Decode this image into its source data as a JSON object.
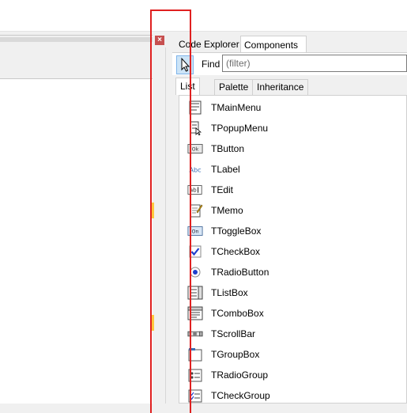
{
  "window": {
    "close_glyph": "×"
  },
  "tabs": {
    "code_explorer": "Code Explorer",
    "components": "Components"
  },
  "toolbar": {
    "pointer_icon": "arrow-cursor-icon",
    "find_label": "Find",
    "filter_placeholder": "(filter)",
    "filter_value": ""
  },
  "subtabs": {
    "list": "List",
    "palette": "Palette",
    "inheritance": "Inheritance"
  },
  "components": [
    {
      "label": "TMainMenu",
      "icon": "mainmenu-icon"
    },
    {
      "label": "TPopupMenu",
      "icon": "popupmenu-icon"
    },
    {
      "label": "TButton",
      "icon": "button-icon"
    },
    {
      "label": "TLabel",
      "icon": "label-icon"
    },
    {
      "label": "TEdit",
      "icon": "edit-icon"
    },
    {
      "label": "TMemo",
      "icon": "memo-icon"
    },
    {
      "label": "TToggleBox",
      "icon": "togglebox-icon"
    },
    {
      "label": "TCheckBox",
      "icon": "checkbox-icon"
    },
    {
      "label": "TRadioButton",
      "icon": "radiobutton-icon"
    },
    {
      "label": "TListBox",
      "icon": "listbox-icon"
    },
    {
      "label": "TComboBox",
      "icon": "combobox-icon"
    },
    {
      "label": "TScrollBar",
      "icon": "scrollbar-icon"
    },
    {
      "label": "TGroupBox",
      "icon": "groupbox-icon"
    },
    {
      "label": "TRadioGroup",
      "icon": "radiogroup-icon"
    },
    {
      "label": "TCheckGroup",
      "icon": "checkgroup-icon"
    }
  ],
  "icon_text": {
    "button": "Ok",
    "label": "Abc",
    "edit": "ab",
    "togglebox": "On"
  },
  "colors": {
    "highlight_box": "#e02020",
    "selected_tool": "#cce4f7",
    "checkbox_blue": "#1f3fcc"
  }
}
